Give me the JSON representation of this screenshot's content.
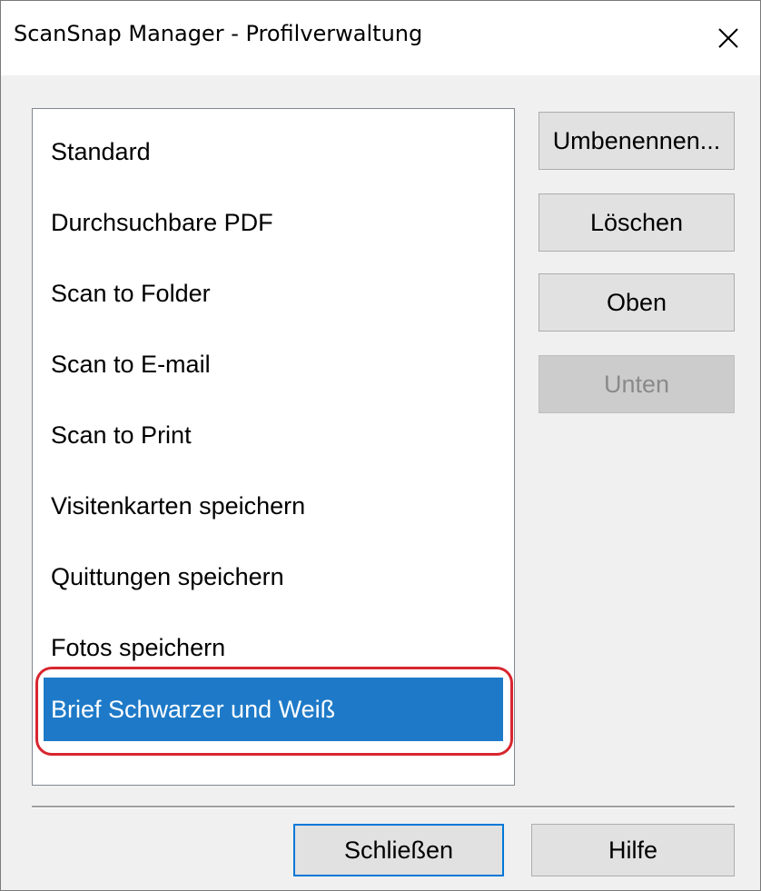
{
  "window": {
    "title": "ScanSnap Manager - Profilverwaltung",
    "close_icon": "close-icon"
  },
  "profiles": {
    "items": [
      "Standard",
      "Durchsuchbare PDF",
      "Scan to Folder",
      "Scan to E-mail",
      "Scan to Print",
      "Visitenkarten speichern",
      "Quittungen speichern",
      "Fotos speichern",
      "Brief Schwarzer und Weiß"
    ],
    "selected_index": 8
  },
  "side_buttons": {
    "rename": "Umbenennen...",
    "delete": "Löschen",
    "up": "Oben",
    "down": "Unten"
  },
  "footer": {
    "close": "Schließen",
    "help": "Hilfe"
  },
  "colors": {
    "selection": "#1e7ac8",
    "highlight_ring": "#d8262f",
    "default_button_border": "#0078d7"
  }
}
